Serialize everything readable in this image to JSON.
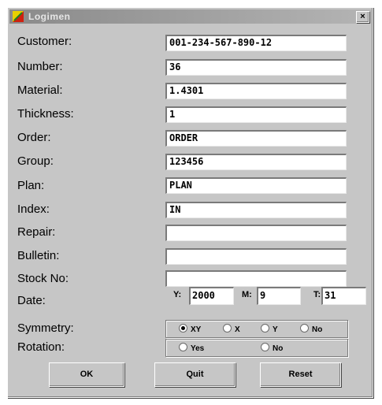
{
  "window": {
    "title": "Logimen",
    "close_glyph": "×"
  },
  "form": {
    "labels": {
      "customer": "Customer:",
      "number": "Number:",
      "material": "Material:",
      "thickness": "Thickness:",
      "order": "Order:",
      "group": "Group:",
      "plan": "Plan:",
      "index": "Index:",
      "repair": "Repair:",
      "bulletin": "Bulletin:",
      "stock_no": "Stock No:",
      "date": "Date:",
      "symmetry": "Symmetry:",
      "rotation": "Rotation:"
    },
    "values": {
      "customer": "001-234-567-890-12",
      "number": "36",
      "material": "1.4301",
      "thickness": "1",
      "order": "ORDER",
      "group": "123456",
      "plan": "PLAN",
      "index": "IN",
      "repair": "",
      "bulletin": "",
      "stock_no": ""
    },
    "date": {
      "y_label": "Y:",
      "y_value": "2000",
      "m_label": "M:",
      "m_value": "9",
      "t_label": "T:",
      "t_value": "31"
    },
    "symmetry": {
      "options": [
        "XY",
        "X",
        "Y",
        "No"
      ],
      "selected": "XY"
    },
    "rotation": {
      "options": [
        "Yes",
        "No"
      ],
      "selected": ""
    }
  },
  "buttons": {
    "ok": "OK",
    "quit": "Quit",
    "reset": "Reset"
  },
  "colors": {
    "dialog_bg": "#c6c6c6",
    "titlebar": "#9a9a9a"
  }
}
